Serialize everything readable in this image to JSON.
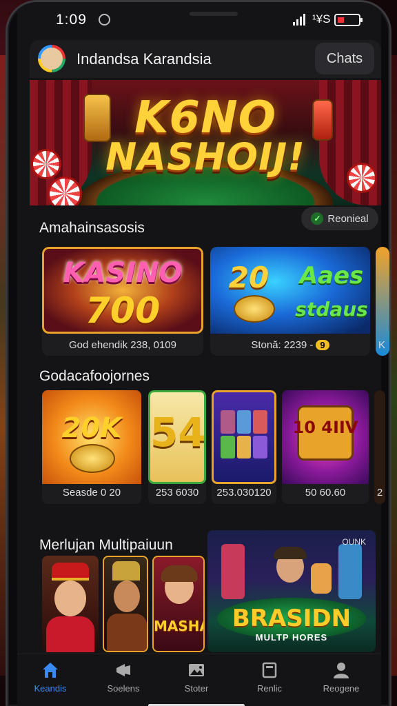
{
  "status_bar": {
    "time": "1:09",
    "network": "¹¥S"
  },
  "header": {
    "title": "Indandsa Karandsia",
    "chats_label": "Chats"
  },
  "hero": {
    "line1": "K6NO",
    "line2": "NASHOIJ!"
  },
  "section1": {
    "title": "Amahainsasosis",
    "button_label": "Reonieal",
    "cards": [
      {
        "art_line1": "KASINO",
        "art_line2": "700",
        "caption": "God ehendik 238, 0109"
      },
      {
        "art_line1": "20",
        "art_line2": "Aaes",
        "art_line3": "stdaus",
        "caption": "Stonă: 2239 -",
        "badge": "9"
      },
      {
        "caption": "K"
      }
    ]
  },
  "section2": {
    "title": "Godacafoojornes",
    "cards": [
      {
        "art": "20K",
        "caption": "Seasde 0 20"
      },
      {
        "art": "54",
        "caption": "253 6030"
      },
      {
        "caption": "253.030120"
      },
      {
        "art": "10 4IIV",
        "caption": "50 60.60"
      },
      {
        "caption": "2"
      }
    ]
  },
  "section3": {
    "title": "Merlujan Multipaiuun",
    "cards": [
      {},
      {},
      {
        "art": "MASHA"
      }
    ],
    "featured": {
      "title": "BRASIDN",
      "subtitle": "MULTP HORES",
      "corner": "OUNK"
    }
  },
  "nav": [
    {
      "label": "Keandis",
      "icon": "home-icon",
      "active": true
    },
    {
      "label": "Soelens",
      "icon": "megaphone-icon",
      "active": false
    },
    {
      "label": "Stoter",
      "icon": "photo-icon",
      "active": false
    },
    {
      "label": "Renlic",
      "icon": "stack-icon",
      "active": false
    },
    {
      "label": "Reogene",
      "icon": "person-icon",
      "active": false
    }
  ],
  "colors": {
    "accent": "#3a8af5",
    "gold": "#ffd23a",
    "background": "#141416"
  }
}
